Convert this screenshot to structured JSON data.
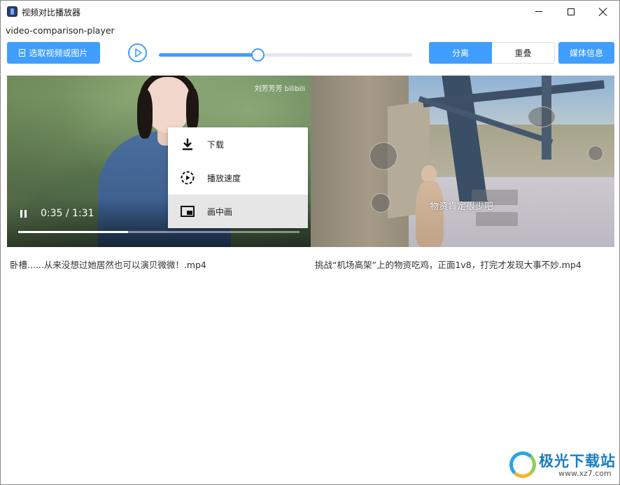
{
  "window": {
    "title": "视频对比播放器",
    "subtitle": "video-comparison-player"
  },
  "toolbar": {
    "select_label": "选取视频或图片",
    "progress_percent": 39,
    "mode_split_label": "分离",
    "mode_overlay_label": "重叠",
    "active_mode": "分离",
    "media_info_label": "媒体信息",
    "accent_color": "#409eff"
  },
  "left_video": {
    "watermark": "刘芳芳芳 bilibili",
    "time": "0:35 / 1:31",
    "progress_percent": 39,
    "filename": "卧槽......从来没想过她居然也可以演贝微微！.mp4"
  },
  "context_menu": {
    "items": [
      {
        "label": "下载",
        "icon": "download-icon"
      },
      {
        "label": "播放速度",
        "icon": "speed-icon"
      },
      {
        "label": "画中画",
        "icon": "picture-in-picture-icon",
        "highlighted": true
      }
    ]
  },
  "right_video": {
    "subtitle_text": "物资肯定很少吧",
    "filename": "挑战“机场高架”上的物资吃鸡，正面1v8，打完才发现大事不妙.mp4"
  },
  "brand": {
    "name": "极光下载站",
    "url": "www.xz7.com"
  }
}
